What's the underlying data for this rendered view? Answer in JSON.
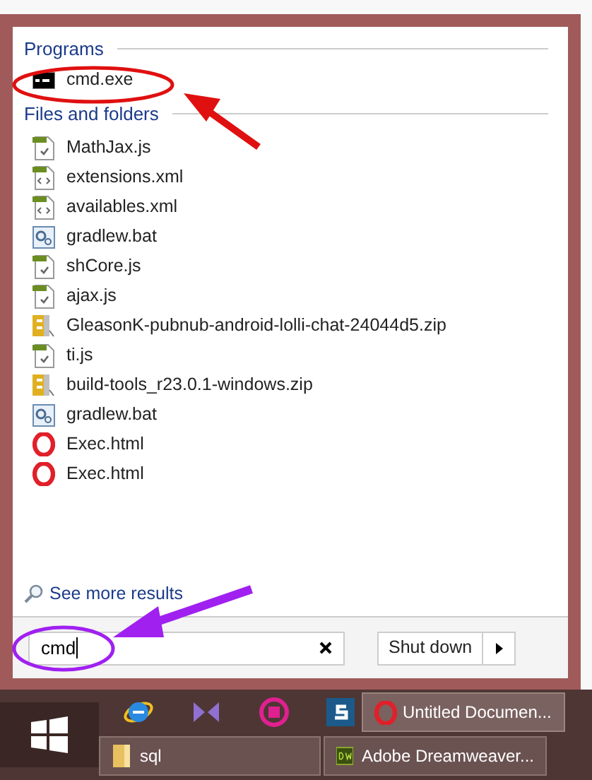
{
  "programs": {
    "heading": "Programs",
    "items": [
      {
        "label": "cmd.exe",
        "kind": "console"
      }
    ]
  },
  "files": {
    "heading": "Files and folders",
    "items": [
      {
        "label": "MathJax.js",
        "kind": "script"
      },
      {
        "label": "extensions.xml",
        "kind": "markup"
      },
      {
        "label": "availables.xml",
        "kind": "markup"
      },
      {
        "label": "gradlew.bat",
        "kind": "batch"
      },
      {
        "label": "shCore.js",
        "kind": "script"
      },
      {
        "label": "ajax.js",
        "kind": "script"
      },
      {
        "label": "GleasonK-pubnub-android-lolli-chat-24044d5.zip",
        "kind": "archive"
      },
      {
        "label": "ti.js",
        "kind": "script"
      },
      {
        "label": "build-tools_r23.0.1-windows.zip",
        "kind": "archive"
      },
      {
        "label": "gradlew.bat",
        "kind": "batch"
      },
      {
        "label": "Exec.html",
        "kind": "browser"
      },
      {
        "label": "Exec.html",
        "kind": "browser"
      }
    ]
  },
  "see_more": "See more results",
  "search": {
    "value": "cmd"
  },
  "shutdown": {
    "label": "Shut down"
  },
  "taskbar": {
    "pinned": [
      {
        "kind": "ie"
      },
      {
        "kind": "vs"
      },
      {
        "kind": "pink"
      },
      {
        "kind": "s"
      }
    ],
    "windows": [
      {
        "label": "Untitled Documen...",
        "kind": "browser"
      },
      {
        "label": "sql",
        "kind": "folder"
      },
      {
        "label": "Adobe Dreamweaver...",
        "kind": "dw"
      }
    ]
  }
}
